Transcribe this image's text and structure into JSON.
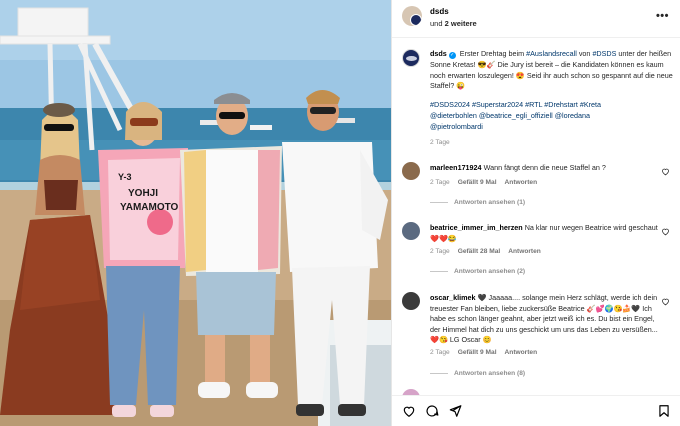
{
  "post": {
    "username": "dsds",
    "subtitle_prefix": "und",
    "subtitle_bold": "2 weitere",
    "more_label": "•••"
  },
  "caption": {
    "username": "dsds",
    "text1": "Erster Drehtag beim ",
    "tag1": "#Auslandsrecall",
    "text2": " von ",
    "tag2": "#DSDS",
    "text3": " unter der heißen Sonne Kretas! 😎🎸 Die Jury ist bereit – die Kandidaten können es kaum noch erwarten loszulegen! 😍 Seid ihr auch schon so gespannt auf die neue Staffel? 😜",
    "hashtags": "#DSDS2024 #Superstar2024 #RTL #Drehstart #Kreta",
    "mention1": "@dieterbohlen",
    "mention2": "@beatrice_egli_offiziell",
    "mention3": "@loredana",
    "mention4": "@pietrolombardi",
    "age": "2 Tage"
  },
  "comments": [
    {
      "username": "marleen171924",
      "text": "Wann fängt denn die neue Staffel an ?",
      "age": "2 Tage",
      "likes": "Gefällt 9 Mal",
      "reply": "Antworten",
      "view_replies": "Antworten ansehen (1)"
    },
    {
      "username": "beatrice_immer_im_herzen",
      "text": "Na klar nur wegen Beatrice wird geschaut ❤️❤️😂",
      "age": "2 Tage",
      "likes": "Gefällt 28 Mal",
      "reply": "Antworten",
      "view_replies": "Antworten ansehen (2)"
    },
    {
      "username": "oscar_klimek",
      "text": "🖤 Jaaaaa.... solange mein Herz schlägt, werde ich dein treuester Fan bleiben, liebe zuckersüße Beatrice 🎸💕🌍😘🍰🖤 Ich habe es schon länger geahnt, aber jetzt weiß ich es. Du bist ein Engel, der Himmel hat dich zu uns geschickt um uns das Leben zu versüßen... ❤️😘 LG Oscar 😊",
      "age": "2 Tage",
      "likes": "Gefällt 9 Mal",
      "reply": "Antworten",
      "view_replies": "Antworten ansehen (8)"
    }
  ],
  "footer": {
    "icons": [
      "heart-icon",
      "comment-icon",
      "share-icon",
      "bookmark-icon"
    ]
  },
  "photo": {
    "shirt_text_line1": "Y-3",
    "shirt_text_line2": "YOHJI",
    "shirt_text_line3": "YAMAMOTO"
  },
  "colors": {
    "link": "#00376b",
    "verified": "#0095f6",
    "meta": "#8e8e8e"
  }
}
